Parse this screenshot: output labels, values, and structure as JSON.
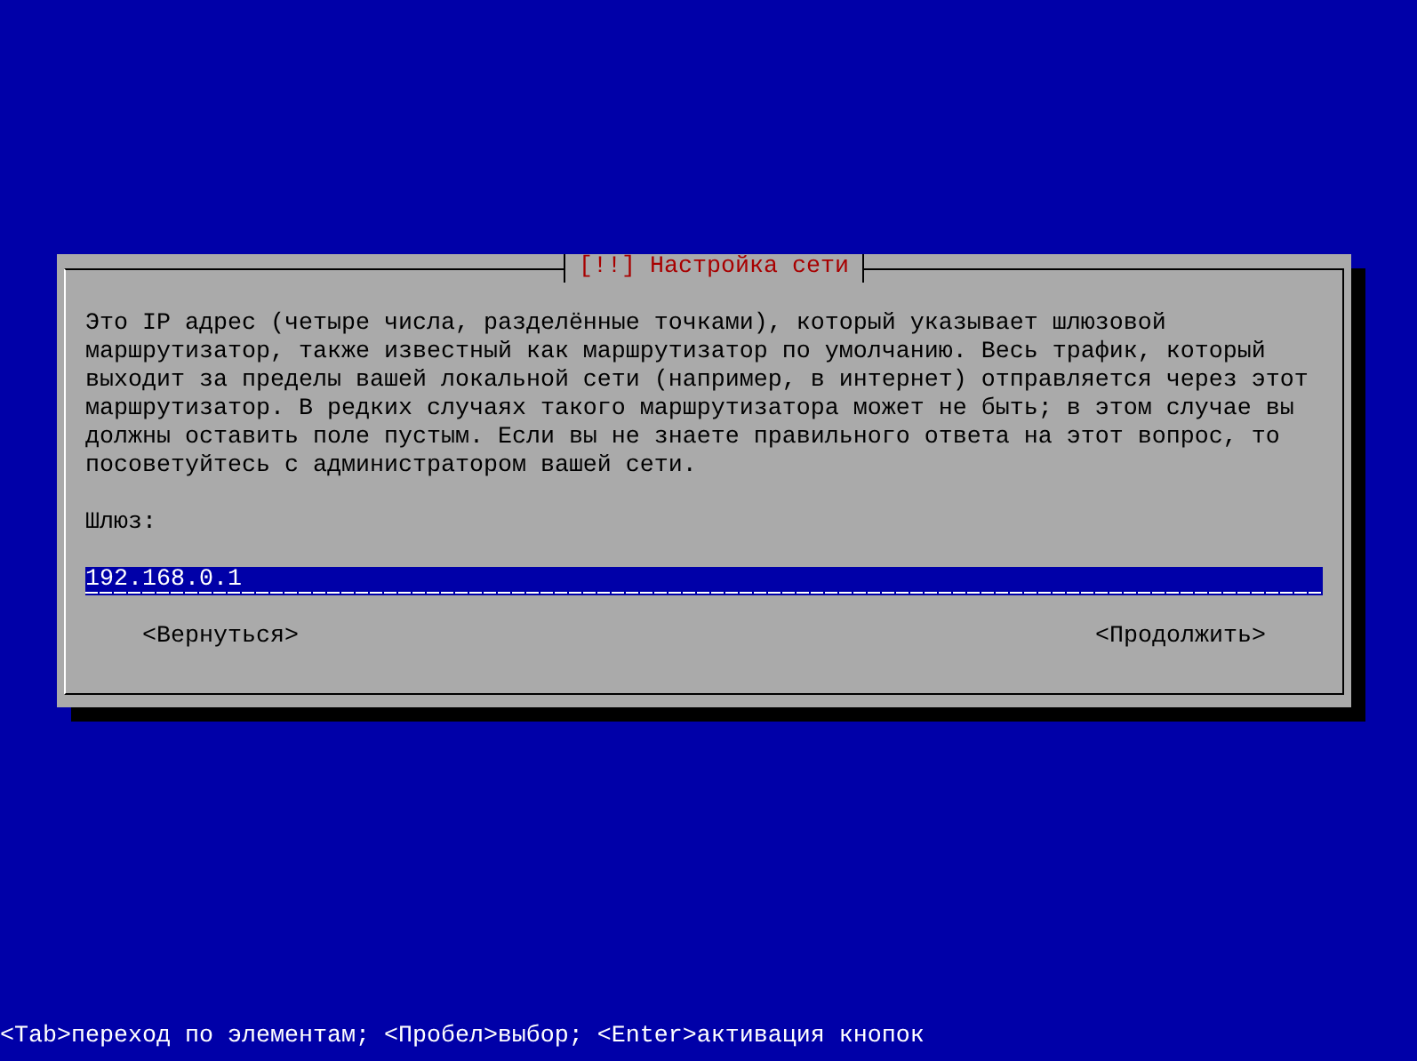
{
  "dialog": {
    "title": "[!!] Настройка сети",
    "description": "Это IP адрес (четыре числа, разделённые точками), который указывает шлюзовой маршрутизатор, также известный как маршрутизатор по умолчанию. Весь трафик, который выходит за пределы вашей локальной сети (например, в интернет) отправляется через этот маршрутизатор. В редких случаях такого маршрутизатора может не быть; в этом случае вы должны оставить поле пустым. Если вы не знаете правильного ответа на этот вопрос, то посоветуйтесь с администратором вашей сети.",
    "field": {
      "label": "Шлюз:",
      "value": "192.168.0.1"
    },
    "buttons": [
      {
        "label": "<Вернуться>"
      },
      {
        "label": "<Продолжить>"
      }
    ]
  },
  "status_bar": "<Tab>переход по элементам; <Пробел>выбор; <Enter>активация кнопок"
}
